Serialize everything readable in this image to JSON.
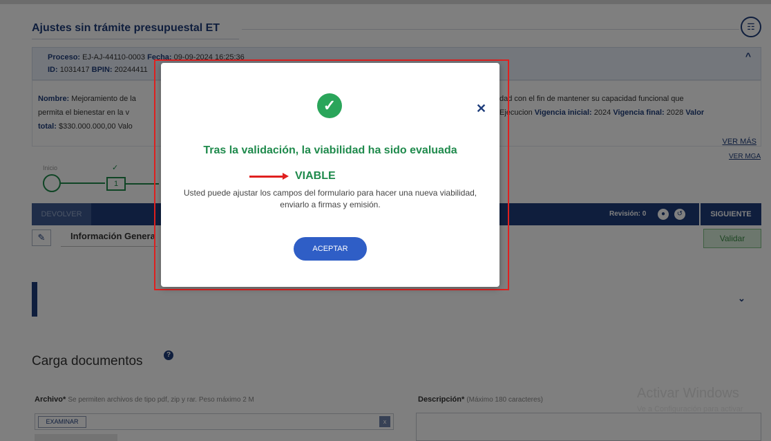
{
  "page": {
    "title": "Ajustes sin trámite presupuestal ET",
    "org_icon": "org-chart-icon"
  },
  "process": {
    "proceso_label": "Proceso:",
    "proceso_value": "EJ-AJ-44110-0003",
    "fecha_label": "Fecha:",
    "fecha_value": "09-09-2024 16:25:36",
    "id_label": "ID:",
    "id_value": "1031417",
    "bpin_label": "BPIN:",
    "bpin_value": "20244411"
  },
  "project": {
    "nombre_label": "Nombre:",
    "nombre_value": "Mejoramiento de la",
    "nombre_line2": "permita el bienestar en la v",
    "valor_total_label": "total:",
    "valor_total_value": "$330.000.000,00 Valo",
    "right_line1": "dad con el fin de mantener su capacidad funcional que",
    "right_line2_prefix": "Ejecucion",
    "vigencia_inicial_label": "Vigencia inicial:",
    "vigencia_inicial_value": "2024",
    "vigencia_final_label": "Vigencia final:",
    "vigencia_final_value": "2028",
    "valor_label": "Valor",
    "ver_mas": "VER MÁS",
    "ver_mga": "VER MGA"
  },
  "stepper": {
    "start_label": "Inicio",
    "step1_number": "1"
  },
  "toolbar": {
    "devolver": "DEVOLVER",
    "revision_label": "Revisión: 0",
    "siguiente": "SIGUIENTE",
    "validar": "Validar"
  },
  "info": {
    "title": "Información Genera"
  },
  "carga": {
    "title": "Carga documentos",
    "archivo_label": "Archivo*",
    "archivo_hint": "Se permiten archivos de tipo pdf, zip y rar. Peso máximo 2 M",
    "examinar": "EXAMINAR",
    "descripcion_label": "Descripción*",
    "descripcion_hint": "(Máximo 180 caracteres)"
  },
  "watermark": {
    "line1": "Activar Windows",
    "line2": "Ve a Configuración para activar"
  },
  "modal": {
    "title": "Tras la validación, la viabilidad ha sido evaluada",
    "status": "VIABLE",
    "body": "Usted puede ajustar los campos del formulario para hacer una nueva viabilidad, enviarlo a firmas y emisión.",
    "accept": "ACEPTAR",
    "close": "✕",
    "colors": {
      "success": "#1f8a4c",
      "accept_button": "#2f5ec6",
      "highlight": "#e0201f"
    }
  }
}
